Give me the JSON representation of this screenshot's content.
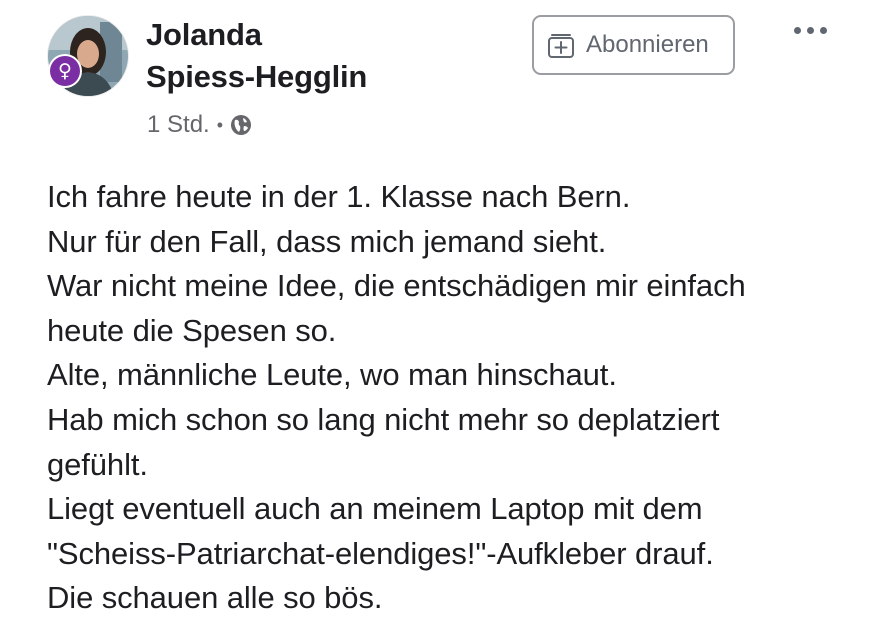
{
  "post": {
    "author": {
      "name_line1": "Jolanda",
      "name_line2": "Spiess-Hegglin",
      "avatar_badge_icon": "venus-symbol-icon",
      "avatar_badge_glyph": "♀",
      "avatar_badge_color": "#7b2ea3"
    },
    "meta": {
      "time": "1 Std.",
      "separator": "•",
      "privacy_icon": "globe-icon"
    },
    "actions": {
      "subscribe_label": "Abonnieren",
      "subscribe_icon": "follow-plus-icon",
      "more_icon": "more-options-icon"
    },
    "text_lines": [
      "Ich fahre heute in der 1. Klasse nach Bern.",
      "Nur für den Fall, dass mich jemand sieht.",
      "War nicht meine Idee, die entschädigen mir einfach",
      "heute die Spesen so.",
      "Alte, männliche Leute, wo man hinschaut.",
      "Hab mich schon so lang nicht mehr so deplatziert",
      "gefühlt.",
      "Liegt eventuell auch an meinem Laptop mit dem",
      "\"Scheiss-Patriarchat-elendiges!\"-Aufkleber drauf.",
      "Die schauen alle so bös."
    ]
  },
  "colors": {
    "text": "#1c1e21",
    "secondary_text": "#65676b",
    "button_border": "#9a9da1"
  }
}
